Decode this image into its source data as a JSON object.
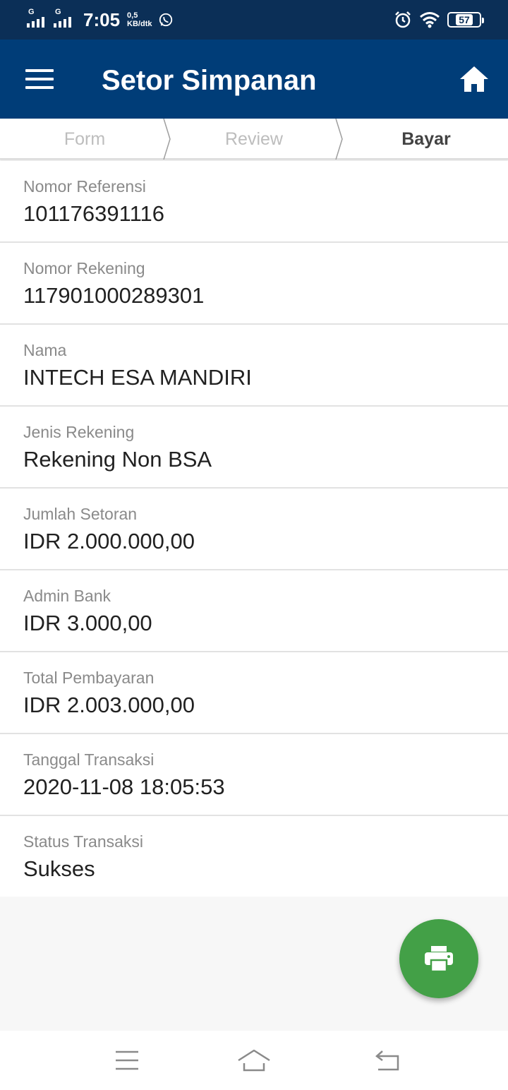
{
  "status_bar": {
    "network_1": "G",
    "network_2": "G",
    "time": "7:05",
    "speed_value": "0,5",
    "speed_unit": "KB/dtk",
    "battery": "57",
    "icons": [
      "signal-icon",
      "signal-icon",
      "whatsapp-icon",
      "alarm-icon",
      "wifi-icon",
      "battery-icon"
    ]
  },
  "app_bar": {
    "title": "Setor Simpanan",
    "menu_icon": "hamburger-menu-icon",
    "home_icon": "home-icon",
    "color": "#003d78"
  },
  "stepper": {
    "steps": [
      {
        "label": "Form",
        "state": "done"
      },
      {
        "label": "Review",
        "state": "done"
      },
      {
        "label": "Bayar",
        "state": "active"
      }
    ]
  },
  "details": [
    {
      "label": "Nomor Referensi",
      "value": "101176391116"
    },
    {
      "label": "Nomor Rekening",
      "value": "117901000289301"
    },
    {
      "label": "Nama",
      "value": "INTECH ESA MANDIRI"
    },
    {
      "label": "Jenis Rekening",
      "value": "Rekening Non BSA"
    },
    {
      "label": "Jumlah Setoran",
      "value": "IDR 2.000.000,00"
    },
    {
      "label": "Admin Bank",
      "value": "IDR 3.000,00"
    },
    {
      "label": "Total Pembayaran",
      "value": "IDR 2.003.000,00"
    },
    {
      "label": "Tanggal Transaksi",
      "value": "2020-11-08 18:05:53"
    },
    {
      "label": "Status Transaksi",
      "value": "Sukses"
    }
  ],
  "fab": {
    "icon": "print-icon",
    "color": "#43a047"
  },
  "nav_bar": {
    "icons": [
      "recent-apps-icon",
      "home-nav-icon",
      "back-icon"
    ]
  }
}
